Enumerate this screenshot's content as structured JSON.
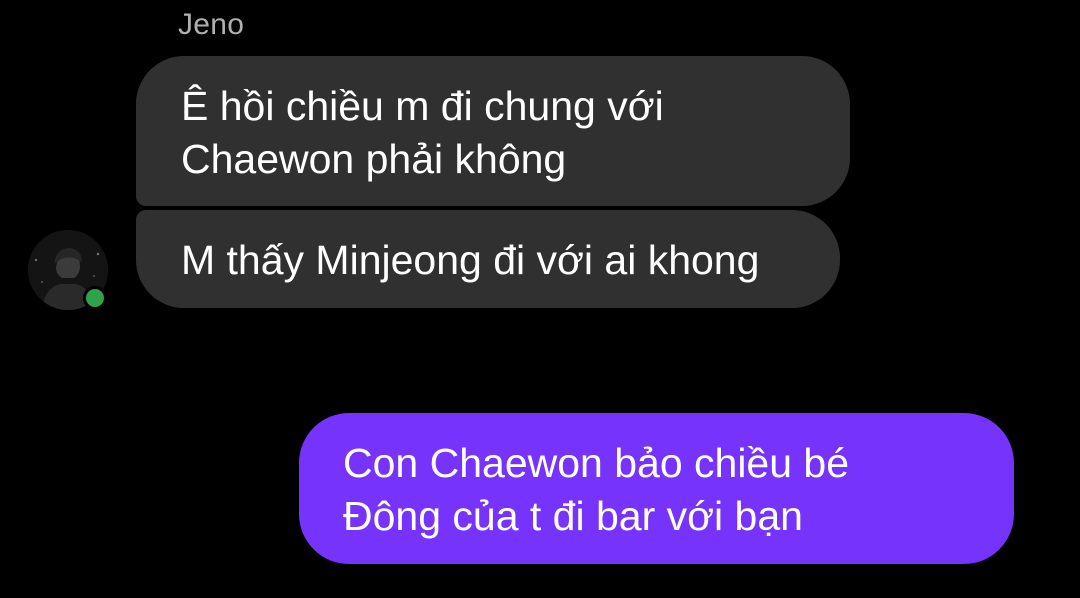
{
  "conversation": {
    "sender_name": "Jeno",
    "incoming_messages": [
      {
        "lines": [
          "Ê hồi chiều m đi chung với",
          "Chaewon phải không"
        ]
      },
      {
        "lines": [
          "M thấy Minjeong đi với ai khong"
        ]
      }
    ],
    "outgoing_messages": [
      {
        "lines": [
          "Con Chaewon bảo chiều bé",
          "Đông của t đi bar với bạn"
        ]
      }
    ]
  },
  "colors": {
    "background": "#000000",
    "incoming_bubble": "#303030",
    "outgoing_bubble": "#7533fb",
    "sender_name": "#b0b0b0",
    "presence": "#31a24c"
  },
  "icons": {
    "avatar": "user-avatar-photo",
    "presence": "online-status-dot"
  }
}
